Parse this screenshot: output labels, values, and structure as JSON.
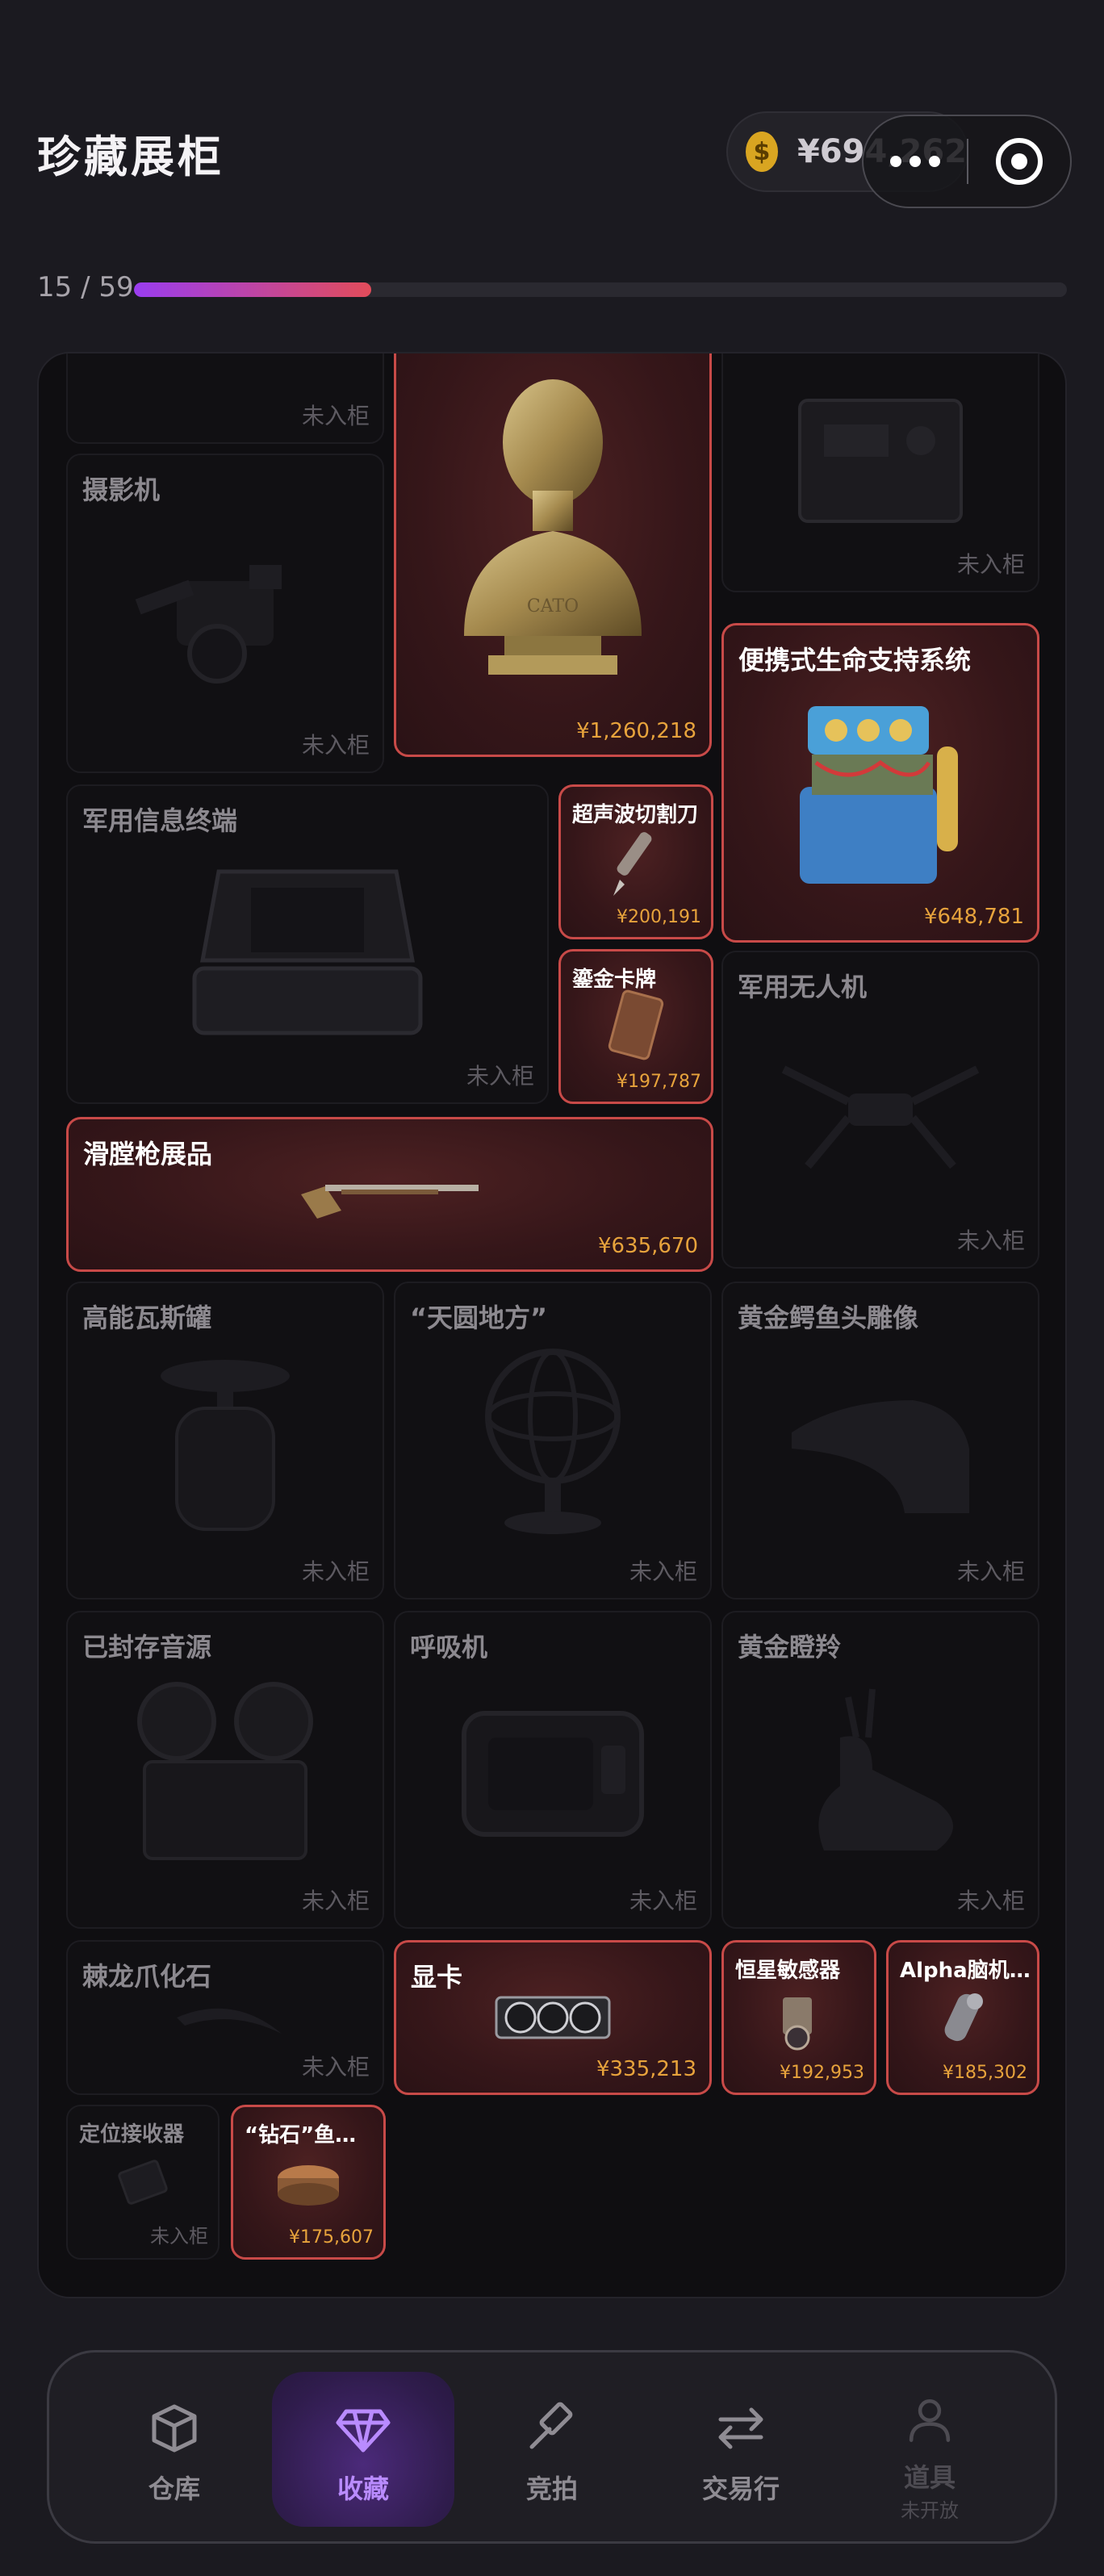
{
  "header": {
    "title": "珍藏展柜",
    "balance": "¥694,262",
    "coin_symbol": "$"
  },
  "progress": {
    "label": "15 / 59",
    "owned": 15,
    "total": 59,
    "fraction": 0.254
  },
  "colors": {
    "accent_purple": "#9a3df0",
    "accent_red": "#e24c5a",
    "price_gold": "#e7a33c",
    "owned_border": "#c84a48"
  },
  "slots": {
    "top_left": {
      "status": "未入柜"
    },
    "bust": {
      "price": "¥1,260,218",
      "inscription": "CATO"
    },
    "top_right": {
      "status": "未入柜"
    },
    "camera": {
      "name": "摄影机",
      "status": "未入柜"
    },
    "life_support": {
      "name": "便携式生命支持系统",
      "price": "¥648,781"
    },
    "military_terminal": {
      "name": "军用信息终端",
      "status": "未入柜"
    },
    "ultrasonic_knife": {
      "name": "超声波切割刀",
      "price": "¥200,191"
    },
    "gilded_card": {
      "name": "鎏金卡牌",
      "price": "¥197,787"
    },
    "military_drone": {
      "name": "军用无人机",
      "status": "未入柜"
    },
    "smoothbore": {
      "name": "滑膛枪展品",
      "price": "¥635,670"
    },
    "gas_canister": {
      "name": "高能瓦斯罐",
      "status": "未入柜"
    },
    "armillary": {
      "name": "“天圆地方”",
      "status": "未入柜"
    },
    "croc_head": {
      "name": "黄金鳄鱼头雕像",
      "status": "未入柜"
    },
    "sealed_source": {
      "name": "已封存音源",
      "status": "未入柜"
    },
    "respirator": {
      "name": "呼吸机",
      "status": "未入柜"
    },
    "golden_antelope": {
      "name": "黄金瞪羚",
      "status": "未入柜"
    },
    "raptor_claw": {
      "name": "棘龙爪化石",
      "status": "未入柜"
    },
    "gpu": {
      "name": "显卡",
      "price": "¥335,213"
    },
    "star_sensor": {
      "name": "恒星敏感器",
      "price": "¥192,953"
    },
    "alpha_brain": {
      "name": "Alpha脑机…",
      "price": "¥185,302"
    },
    "locator": {
      "name": "定位接收器",
      "status": "未入柜"
    },
    "diamond_fish": {
      "name": "“钻石”鱼…",
      "price": "¥175,607"
    }
  },
  "nav": {
    "items": [
      {
        "label": "仓库",
        "icon": "box-icon"
      },
      {
        "label": "收藏",
        "icon": "diamond-icon"
      },
      {
        "label": "竞拍",
        "icon": "gavel-icon"
      },
      {
        "label": "交易行",
        "icon": "swap-icon"
      },
      {
        "label": "道具",
        "sub": "未开放",
        "icon": "user-icon"
      }
    ]
  }
}
